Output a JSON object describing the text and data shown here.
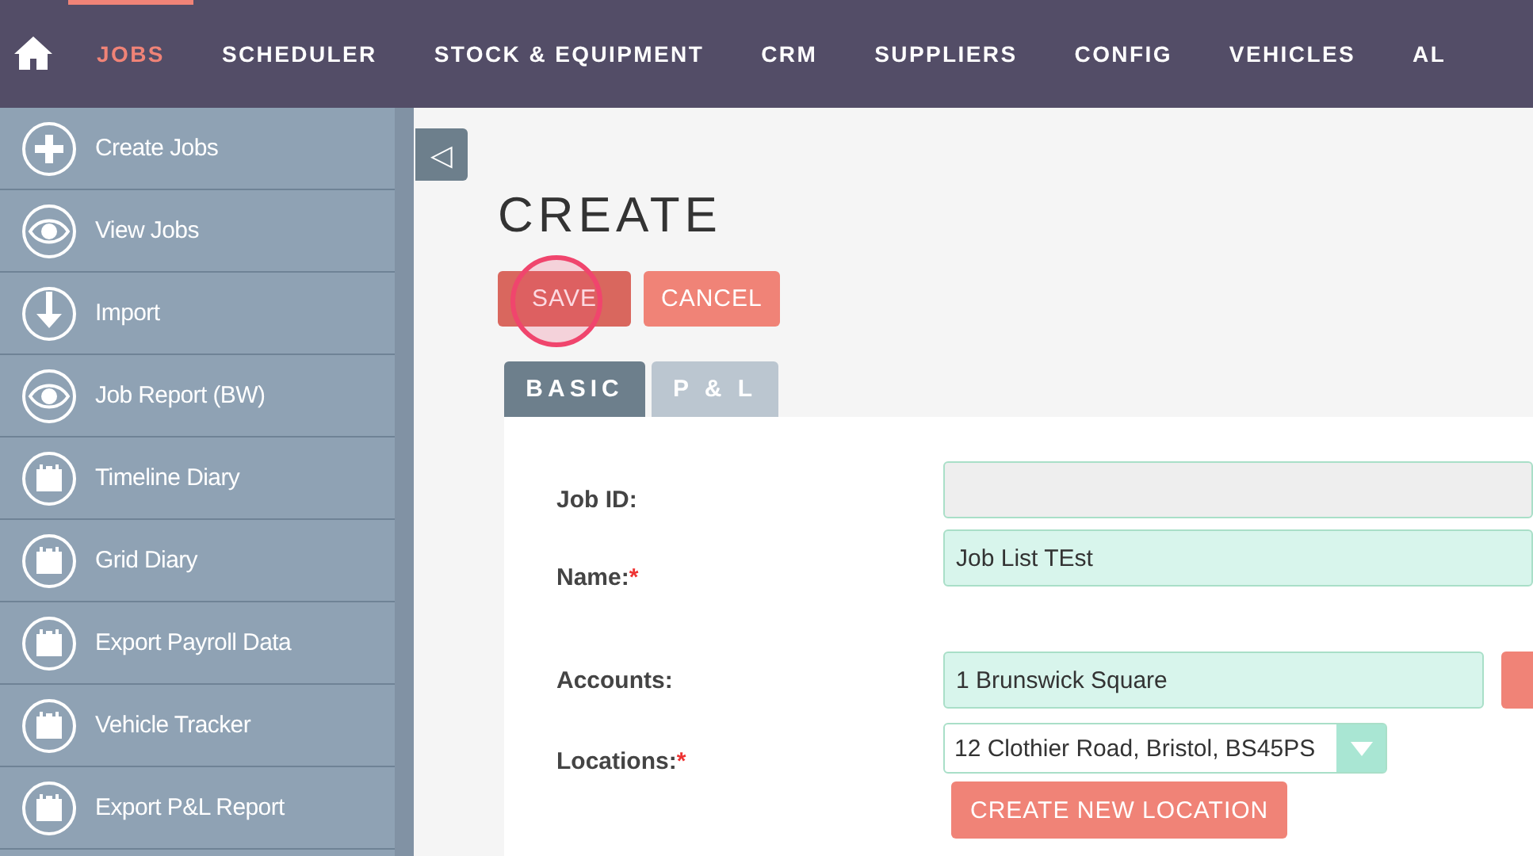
{
  "nav": {
    "items": [
      {
        "label": "JOBS",
        "selected": true
      },
      {
        "label": "SCHEDULER",
        "selected": false
      },
      {
        "label": "STOCK & EQUIPMENT",
        "selected": false
      },
      {
        "label": "CRM",
        "selected": false
      },
      {
        "label": "SUPPLIERS",
        "selected": false
      },
      {
        "label": "CONFIG",
        "selected": false
      },
      {
        "label": "VEHICLES",
        "selected": false
      },
      {
        "label": "AL",
        "selected": false
      }
    ]
  },
  "sidebar": {
    "items": [
      {
        "label": "Create Jobs",
        "kind": "plus"
      },
      {
        "label": "View Jobs",
        "kind": "eye"
      },
      {
        "label": "Import",
        "kind": "download"
      },
      {
        "label": "Job Report (BW)",
        "kind": "eye"
      },
      {
        "label": "Timeline Diary",
        "kind": "calendar"
      },
      {
        "label": "Grid Diary",
        "kind": "calendar"
      },
      {
        "label": "Export Payroll Data",
        "kind": "calendar"
      },
      {
        "label": "Vehicle Tracker",
        "kind": "calendar"
      },
      {
        "label": "Export P&L Report",
        "kind": "calendar"
      }
    ]
  },
  "collapse_button": {
    "label": "◁"
  },
  "page_title": "CREATE",
  "actions": [
    {
      "label": "SAVE",
      "kind": "primary",
      "clicked": true
    },
    {
      "label": "CANCEL",
      "kind": "secondary",
      "clicked": false
    }
  ],
  "tabs": [
    {
      "label": "BASIC",
      "selected": true
    },
    {
      "label": "P & L",
      "selected": false
    }
  ],
  "form": {
    "fields": [
      {
        "label": "Job ID:",
        "kind": "text",
        "disabled": true
      },
      {
        "label": "Name:",
        "marker": "*",
        "kind": "text",
        "value": "Job List TEst",
        "disabled": false
      },
      {
        "label": "Accounts:",
        "kind": "lookup",
        "value": "1 Brunswick Square",
        "disabled": false
      },
      {
        "label": "Locations:",
        "marker": "*",
        "kind": "select",
        "value": "12 Clothier Road, Bristol, BS45PS",
        "disabled": false,
        "action": "CREATE NEW LOCATION"
      }
    ]
  }
}
